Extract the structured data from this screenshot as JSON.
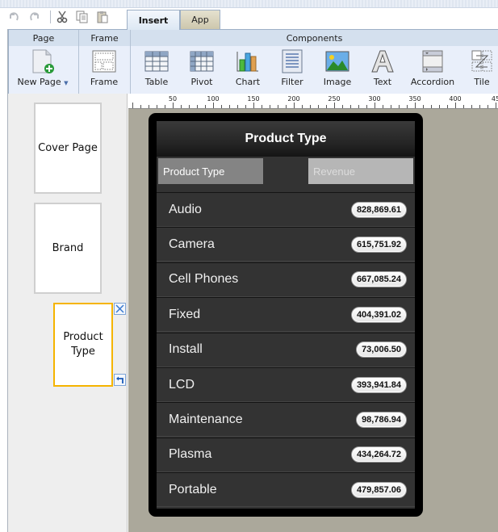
{
  "quick_access": {
    "undo_icon": "undo-icon",
    "redo_icon": "redo-icon",
    "cut_icon": "scissors-icon",
    "copy_icon": "copy-icon",
    "paste_icon": "paste-icon"
  },
  "tabs": [
    {
      "label": "Insert",
      "active": true
    },
    {
      "label": "App",
      "active": false
    }
  ],
  "ribbon": {
    "groups": {
      "page": "Page",
      "frame": "Frame",
      "components": "Components"
    },
    "buttons": {
      "new_page": "New Page",
      "frame": "Frame",
      "table": "Table",
      "pivot": "Pivot",
      "chart": "Chart",
      "filter": "Filter",
      "image": "Image",
      "text": "Text",
      "accordion": "Accordion",
      "tile": "Tile"
    }
  },
  "pages": [
    {
      "label": "Cover Page",
      "selected": false
    },
    {
      "label": "Brand",
      "selected": false
    },
    {
      "label": "Product\nType",
      "selected": true
    }
  ],
  "ruler": {
    "labels": [
      "50",
      "100",
      "150",
      "200",
      "250",
      "300",
      "350",
      "400",
      "45"
    ]
  },
  "panel": {
    "title": "Product Type",
    "columns": {
      "category": "Product Type",
      "value": "Revenue"
    },
    "rows": [
      {
        "name": "Audio",
        "value": "828,869.61"
      },
      {
        "name": "Camera",
        "value": "615,751.92"
      },
      {
        "name": "Cell Phones",
        "value": "667,085.24"
      },
      {
        "name": "Fixed",
        "value": "404,391.02"
      },
      {
        "name": "Install",
        "value": "73,006.50"
      },
      {
        "name": "LCD",
        "value": "393,941.84"
      },
      {
        "name": "Maintenance",
        "value": "98,786.94"
      },
      {
        "name": "Plasma",
        "value": "434,264.72"
      },
      {
        "name": "Portable",
        "value": "479,857.06"
      }
    ]
  },
  "colors": {
    "selection_accent": "#f5b400",
    "canvas_bg": "#aba89b",
    "panel_bg": "#333333"
  }
}
